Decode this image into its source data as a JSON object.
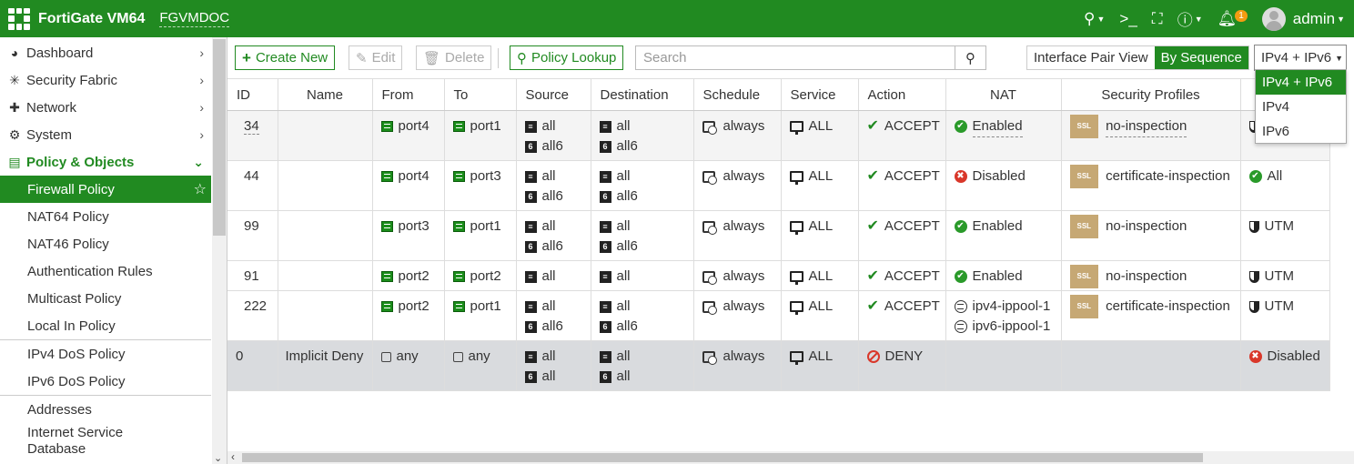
{
  "header": {
    "brand": "FortiGate VM64",
    "hostname": "FGVMDOC",
    "user": "admin",
    "notif_count": "1",
    "colors": {
      "primary": "#218a21"
    }
  },
  "sidebar": {
    "items": [
      {
        "label": "Dashboard",
        "icon": "dashboard-icon"
      },
      {
        "label": "Security Fabric",
        "icon": "fabric-icon"
      },
      {
        "label": "Network",
        "icon": "network-icon"
      },
      {
        "label": "System",
        "icon": "gear-icon"
      },
      {
        "label": "Policy & Objects",
        "icon": "policy-icon"
      }
    ],
    "sub": [
      "Firewall Policy",
      "NAT64 Policy",
      "NAT46 Policy",
      "Authentication Rules",
      "Multicast Policy",
      "Local In Policy",
      "IPv4 DoS Policy",
      "IPv6 DoS Policy",
      "Addresses",
      "Internet Service",
      "Database"
    ]
  },
  "toolbar": {
    "create": "Create New",
    "edit": "Edit",
    "delete": "Delete",
    "lookup": "Policy Lookup",
    "search_placeholder": "Search",
    "pair_view": "Interface Pair View",
    "by_seq": "By Sequence",
    "ip_select": "IPv4 + IPv6"
  },
  "dropdown": [
    "IPv4 + IPv6",
    "IPv4",
    "IPv6"
  ],
  "table": {
    "headers": [
      "ID",
      "Name",
      "From",
      "To",
      "Source",
      "Destination",
      "Schedule",
      "Service",
      "Action",
      "NAT",
      "Security Profiles",
      ""
    ],
    "rows": [
      {
        "id": "34",
        "name": "",
        "from": "port4",
        "to": "port1",
        "src": [
          "all",
          "all6"
        ],
        "dst": [
          "all",
          "all6"
        ],
        "sched": "always",
        "svc": "ALL",
        "action": "ACCEPT",
        "nat": "Enabled",
        "ssl": "no-inspection",
        "log": ""
      },
      {
        "id": "44",
        "name": "",
        "from": "port4",
        "to": "port3",
        "src": [
          "all",
          "all6"
        ],
        "dst": [
          "all",
          "all6"
        ],
        "sched": "always",
        "svc": "ALL",
        "action": "ACCEPT",
        "nat": "Disabled",
        "ssl": "certificate-inspection",
        "log": "All"
      },
      {
        "id": "99",
        "name": "",
        "from": "port3",
        "to": "port1",
        "src": [
          "all",
          "all6"
        ],
        "dst": [
          "all",
          "all6"
        ],
        "sched": "always",
        "svc": "ALL",
        "action": "ACCEPT",
        "nat": "Enabled",
        "ssl": "no-inspection",
        "log": "UTM"
      },
      {
        "id": "91",
        "name": "",
        "from": "port2",
        "to": "port2",
        "src": [
          "all"
        ],
        "dst": [
          "all"
        ],
        "sched": "always",
        "svc": "ALL",
        "action": "ACCEPT",
        "nat": "Enabled",
        "ssl": "no-inspection",
        "log": "UTM"
      },
      {
        "id": "222",
        "name": "",
        "from": "port2",
        "to": "port1",
        "src": [
          "all",
          "all6"
        ],
        "dst": [
          "all",
          "all6"
        ],
        "sched": "always",
        "svc": "ALL",
        "action": "ACCEPT",
        "nat_pools": [
          "ipv4-ippool-1",
          "ipv6-ippool-1"
        ],
        "ssl": "certificate-inspection",
        "log": "UTM"
      },
      {
        "id": "0",
        "name": "Implicit Deny",
        "from": "any",
        "to": "any",
        "src": [
          "all",
          "all"
        ],
        "dst": [
          "all",
          "all"
        ],
        "sched": "always",
        "svc": "ALL",
        "action": "DENY",
        "nat": "",
        "ssl": "",
        "log": "Disabled"
      }
    ]
  }
}
